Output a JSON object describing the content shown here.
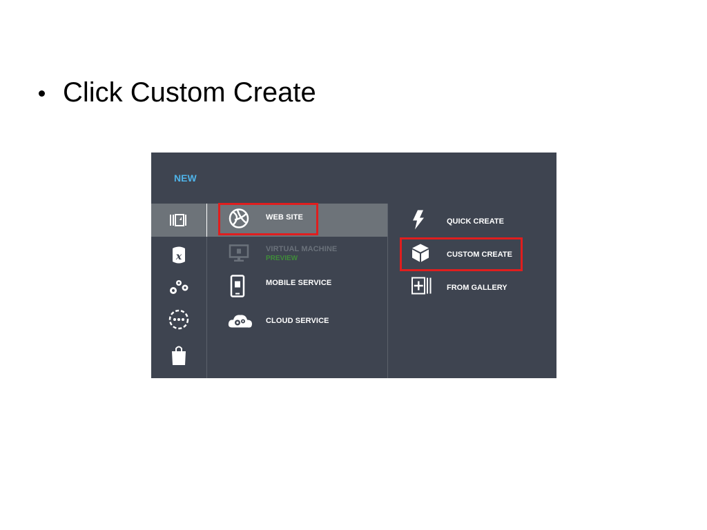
{
  "slide": {
    "bullet_text": "Click Custom Create"
  },
  "panel": {
    "title": "NEW",
    "categories": [
      {
        "icon": "compute-icon",
        "selected": true
      },
      {
        "icon": "database-icon",
        "selected": false
      },
      {
        "icon": "gears-icon",
        "selected": false
      },
      {
        "icon": "network-icon",
        "selected": false
      },
      {
        "icon": "store-bag-icon",
        "selected": false
      }
    ],
    "services": [
      {
        "label": "WEB SITE",
        "icon": "globe-icon",
        "selected": true
      },
      {
        "label": "VIRTUAL MACHINE",
        "sub": "PREVIEW",
        "icon": "monitor-icon",
        "disabled": true
      },
      {
        "label": "MOBILE SERVICE",
        "icon": "mobile-icon"
      },
      {
        "label": "CLOUD SERVICE",
        "icon": "cloud-gear-icon"
      }
    ],
    "actions": [
      {
        "label": "QUICK CREATE",
        "icon": "lightning-icon"
      },
      {
        "label": "CUSTOM CREATE",
        "icon": "box-icon",
        "highlighted": true
      },
      {
        "label": "FROM GALLERY",
        "icon": "gallery-add-icon"
      }
    ]
  },
  "colors": {
    "panel_bg": "#3e4450",
    "selected_bg": "#6d7379",
    "title_blue": "#4fb3e8",
    "highlight_red": "#e01e1e",
    "preview_green": "#3f8c3a"
  }
}
